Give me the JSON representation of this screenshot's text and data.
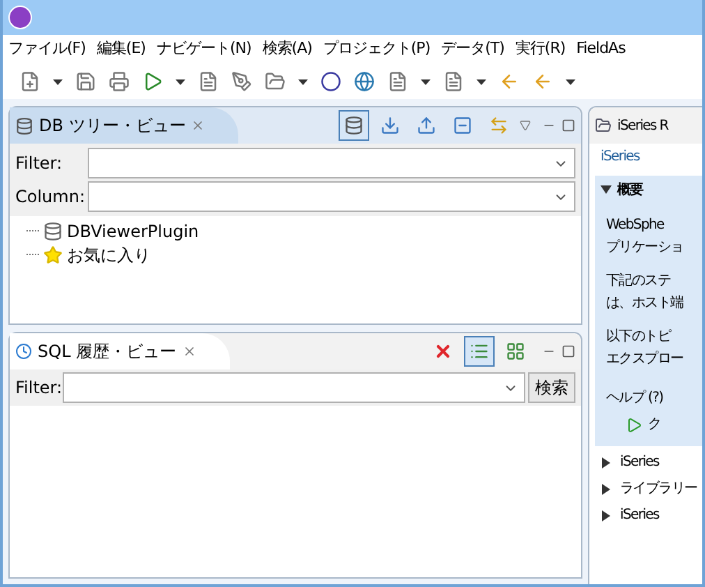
{
  "menu": [
    "ファイル(F)",
    "編集(E)",
    "ナビゲート(N)",
    "検索(A)",
    "プロジェクト(P)",
    "データ(T)",
    "実行(R)",
    "FieldAs"
  ],
  "db_tree_view": {
    "title": "DB ツリー・ビュー",
    "toolbar": [
      {
        "kind": "new-connection",
        "pressed": true
      },
      {
        "kind": "import",
        "pressed": false
      },
      {
        "kind": "export",
        "pressed": false
      },
      {
        "kind": "collapse",
        "pressed": false
      },
      {
        "kind": "link",
        "pressed": false
      }
    ],
    "filter_label": "Filter:",
    "column_label": "Column:",
    "tree": [
      {
        "label": "DBViewerPlugin",
        "kind": "database"
      },
      {
        "label": "お気に入り",
        "kind": "favorites"
      }
    ]
  },
  "sql_history_view": {
    "title": "SQL 履歴・ビュー",
    "toolbar": [
      {
        "kind": "delete",
        "pressed": false
      },
      {
        "kind": "list",
        "pressed": true
      },
      {
        "kind": "grid",
        "pressed": false
      }
    ],
    "filter_label": "Filter:",
    "search_button": "検索"
  },
  "iseries_view": {
    "tab_title": "iSeries R",
    "heading": "iSeries",
    "section": {
      "title": "概要",
      "expanded": true,
      "paragraphs": [
        [
          "WebSphe",
          "プリケーショ"
        ],
        [
          "下記のステ",
          "は、ホスト端"
        ],
        [
          "以下のトピ",
          "エクスプロー"
        ]
      ],
      "help": "ヘルプ (?)",
      "link": "ク"
    },
    "collapsed_sections": [
      {
        "title": "iSeries",
        "expanded": false
      },
      {
        "title": "ライブラリー",
        "expanded": false
      },
      {
        "title": "iSeries",
        "expanded": false
      }
    ]
  }
}
